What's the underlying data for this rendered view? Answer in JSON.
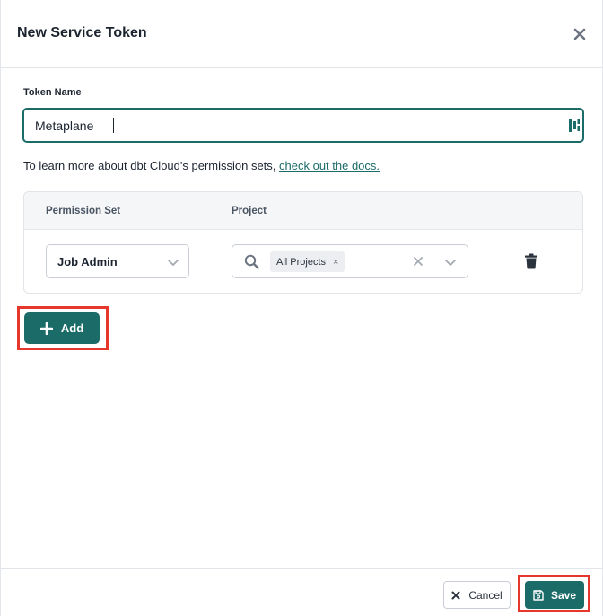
{
  "modal": {
    "title": "New Service Token",
    "close_icon": "close-icon"
  },
  "token_name": {
    "label": "Token Name",
    "value": "Metaplane",
    "extension_icon": "password-manager-icon"
  },
  "help": {
    "text": "To learn more about dbt Cloud's permission sets, ",
    "link_text": "check out the docs."
  },
  "permissions": {
    "headers": {
      "permission_set": "Permission Set",
      "project": "Project"
    },
    "rows": [
      {
        "permission_set": "Job Admin",
        "project_tags": [
          "All Projects"
        ],
        "tag_remove": "×",
        "delete_icon": "trash-icon"
      }
    ]
  },
  "actions": {
    "add_label": "Add",
    "cancel_label": "Cancel",
    "save_label": "Save"
  },
  "colors": {
    "accent": "#1b6b68",
    "highlight": "#e5372b"
  }
}
